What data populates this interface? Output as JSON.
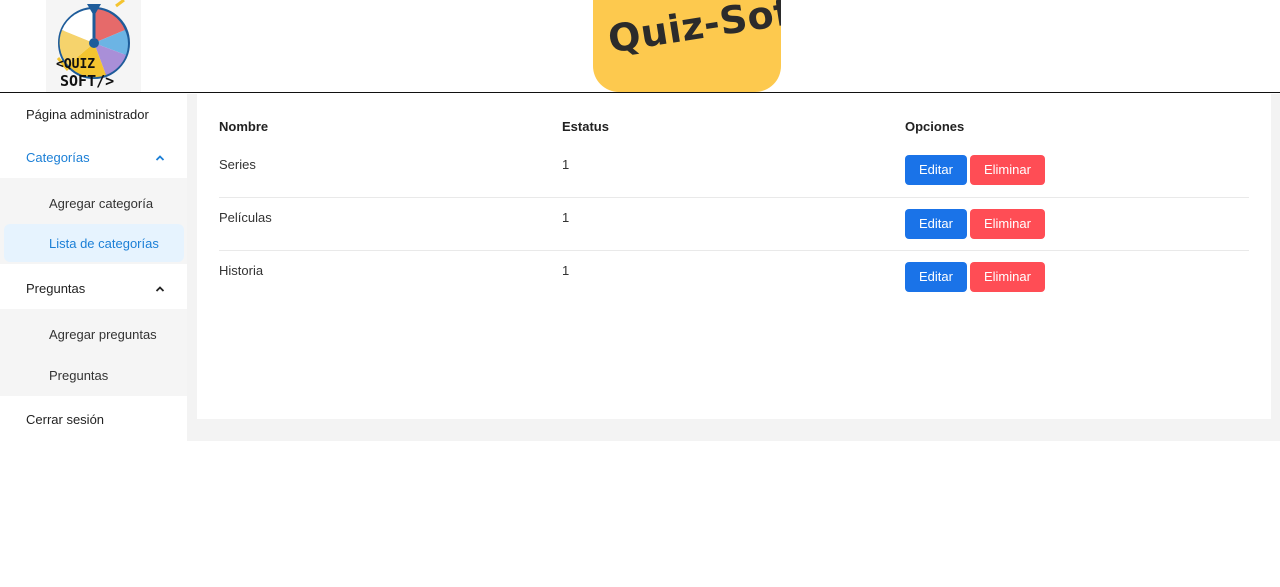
{
  "header": {
    "logo_text_line1": "<QUIZ",
    "logo_text_line2": "SOFT/>",
    "banner_title": "Quiz-Soft"
  },
  "sidebar": {
    "admin_page": "Página administrador",
    "categories": {
      "label": "Categorías",
      "expanded": true,
      "items": [
        {
          "label": "Agregar categoría",
          "selected": false
        },
        {
          "label": "Lista de categorías",
          "selected": true
        }
      ]
    },
    "questions": {
      "label": "Preguntas",
      "expanded": true,
      "items": [
        {
          "label": "Agregar preguntas",
          "selected": false
        },
        {
          "label": "Preguntas",
          "selected": false
        }
      ]
    },
    "logout": "Cerrar sesión"
  },
  "table": {
    "headers": [
      "Nombre",
      "Estatus",
      "Opciones"
    ],
    "rows": [
      {
        "name": "Series",
        "status": "1"
      },
      {
        "name": "Películas",
        "status": "1"
      },
      {
        "name": "Historia",
        "status": "1"
      }
    ],
    "edit_label": "Editar",
    "delete_label": "Eliminar"
  },
  "colors": {
    "accent": "#1b7fd6",
    "edit_button": "#1a73e8",
    "delete_button": "#ff4d55",
    "banner": "#fdc94e"
  }
}
